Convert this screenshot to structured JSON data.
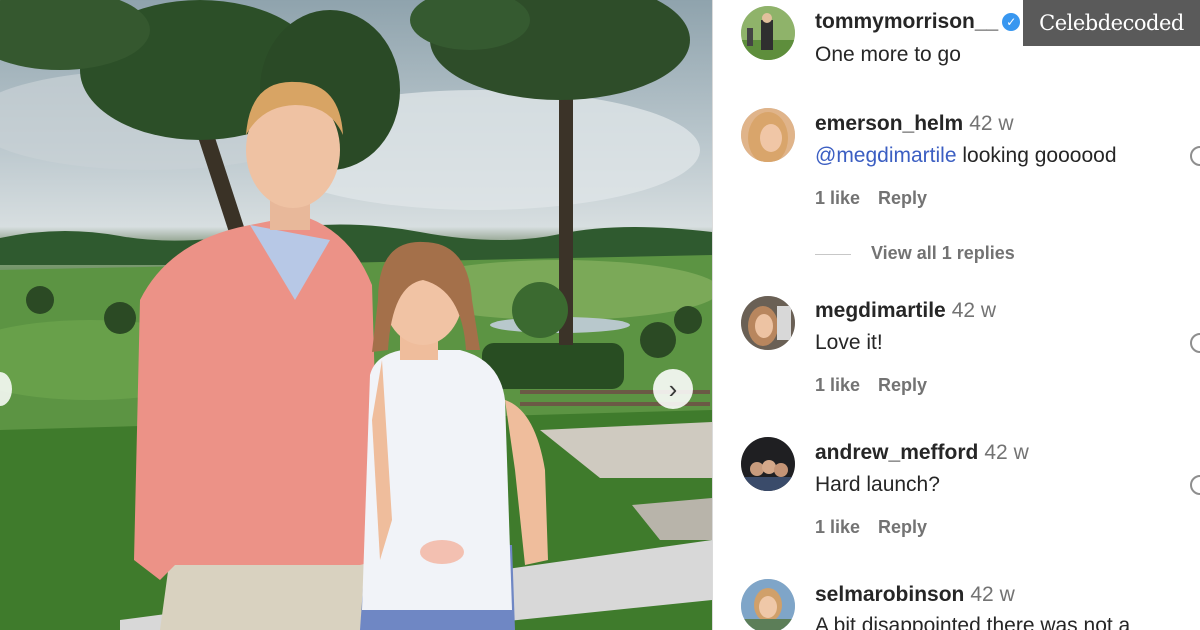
{
  "post": {
    "author": "tommymorrison__",
    "caption": "One more to go"
  },
  "comments": [
    {
      "username": "emerson_helm",
      "age": "42 w",
      "mention": "@megdimartile",
      "text": " looking goooood",
      "likes": "1 like",
      "reply": "Reply",
      "view_replies": "View all 1 replies"
    },
    {
      "username": "megdimartile",
      "age": "42 w",
      "text": "Love it!",
      "likes": "1 like",
      "reply": "Reply"
    },
    {
      "username": "andrew_mefford",
      "age": "42 w",
      "text": "Hard launch?",
      "likes": "1 like",
      "reply": "Reply"
    },
    {
      "username": "selmarobinson",
      "age": "42 w",
      "text": "A bit disappointed there was not a"
    }
  ],
  "watermark": "Celebdecoded",
  "icons": {
    "carousel_next": "chevron-right-icon",
    "verified": "verified-badge-icon",
    "like": "heart-icon"
  },
  "colors": {
    "mention": "#3b5ec2",
    "verified": "#3897f0",
    "muted": "#737373"
  }
}
